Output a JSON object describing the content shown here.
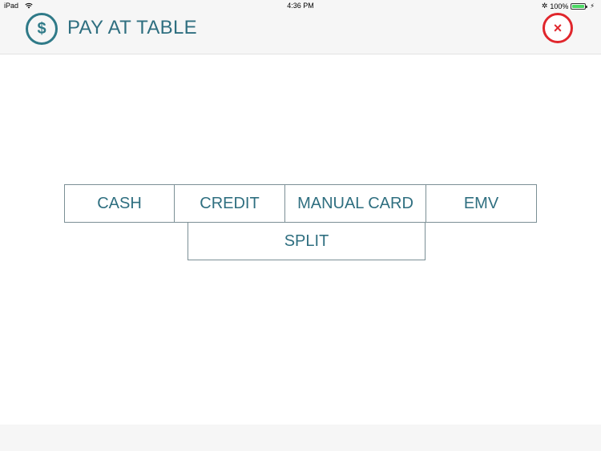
{
  "status_bar": {
    "device": "iPad",
    "time": "4:36 PM",
    "battery": "100%",
    "icons": [
      "wifi-icon",
      "bluetooth-icon",
      "battery-icon",
      "charging-icon"
    ]
  },
  "header": {
    "title": "PAY AT TABLE",
    "icon": "dollar-icon",
    "icon_glyph": "$",
    "close_glyph": "×",
    "colors": {
      "accent": "#2f7a88",
      "close": "#e0262c",
      "background": "#f6f6f6"
    }
  },
  "payment_options": {
    "cash": "CASH",
    "credit": "CREDIT",
    "manual_card": "MANUAL CARD",
    "emv": "EMV",
    "split": "SPLIT"
  }
}
